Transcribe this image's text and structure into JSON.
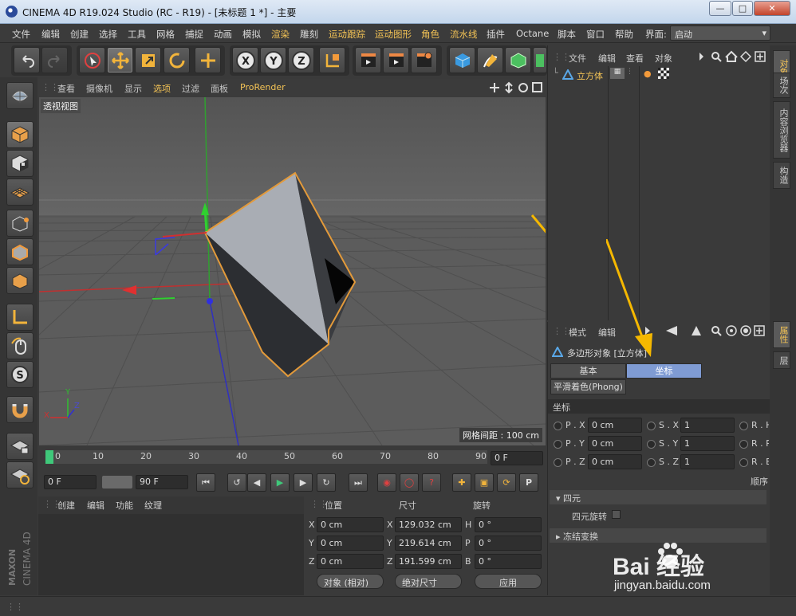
{
  "window": {
    "title": "CINEMA 4D R19.024 Studio (RC - R19) - [未标题 1 *] - 主要"
  },
  "menu": {
    "items": [
      "文件",
      "编辑",
      "创建",
      "选择",
      "工具",
      "网格",
      "捕捉",
      "动画",
      "模拟",
      "渲染",
      "雕刻",
      "运动跟踪",
      "运动图形",
      "角色",
      "流水线",
      "插件",
      "Octane",
      "脚本",
      "窗口",
      "帮助"
    ],
    "layout_label": "界面:",
    "layout_value": "启动"
  },
  "viewport": {
    "menu": [
      "查看",
      "摄像机",
      "显示",
      "选项",
      "过滤",
      "面板",
      "ProRender"
    ],
    "label": "透视视图",
    "grid_spacing": "网格间距 : 100 cm",
    "axis_x": "X",
    "axis_y": "Y",
    "axis_z": "Z"
  },
  "timeline": {
    "ticks": [
      "0",
      "10",
      "20",
      "30",
      "40",
      "50",
      "60",
      "70",
      "80",
      "90"
    ],
    "current_frame": "0 F"
  },
  "transport": {
    "start": "0 F",
    "end": "90 F"
  },
  "material_panel": {
    "menu": [
      "创建",
      "编辑",
      "功能",
      "纹理"
    ]
  },
  "coord_panel": {
    "headers": {
      "position": "位置",
      "size": "尺寸",
      "rotation": "旋转"
    },
    "rows": [
      {
        "axis": "X",
        "pos": "0 cm",
        "size_axis": "X",
        "size": "129.032 cm",
        "rot_axis": "H",
        "rot": "0 °"
      },
      {
        "axis": "Y",
        "pos": "0 cm",
        "size_axis": "Y",
        "size": "219.614 cm",
        "rot_axis": "P",
        "rot": "0 °"
      },
      {
        "axis": "Z",
        "pos": "0 cm",
        "size_axis": "Z",
        "size": "191.599 cm",
        "rot_axis": "B",
        "rot": "0 °"
      }
    ],
    "mode": "对象 (相对)",
    "size_mode": "绝对尺寸",
    "apply": "应用"
  },
  "object_manager": {
    "menu": [
      "文件",
      "编辑",
      "查看",
      "对象"
    ],
    "objects": [
      {
        "name": "立方体"
      }
    ]
  },
  "attribute_manager": {
    "menu": [
      "模式",
      "编辑"
    ],
    "object_title": "多边形对象 [立方体]",
    "tabs": [
      "基本",
      "坐标"
    ],
    "active_tab": "坐标",
    "sub_tab": "平滑着色(Phong)",
    "section": "坐标",
    "fields": [
      {
        "p_label": "P . X",
        "p_val": "0 cm",
        "s_label": "S . X",
        "s_val": "1",
        "r_label": "R . H"
      },
      {
        "p_label": "P . Y",
        "p_val": "0 cm",
        "s_label": "S . Y",
        "s_val": "1",
        "r_label": "R . P"
      },
      {
        "p_label": "P . Z",
        "p_val": "0 cm",
        "s_label": "S . Z",
        "s_val": "1",
        "r_label": "R . B"
      }
    ],
    "order_label": "顺序",
    "quat_section": "四元",
    "quat_rotation": "四元旋转",
    "freeze_section": "冻结变换"
  },
  "right_tabs": [
    "对象",
    "场次",
    "内容浏览器",
    "构造",
    "属性",
    "层"
  ],
  "branding": {
    "maxon": "MAXON",
    "product": "CINEMA 4D"
  },
  "watermark": {
    "text": "Bai 经验",
    "url": "jingyan.baidu.com"
  },
  "colors": {
    "accent": "#f2c255",
    "active_tab": "#7f9bd3",
    "highlight_arrow": "#f5b800"
  }
}
